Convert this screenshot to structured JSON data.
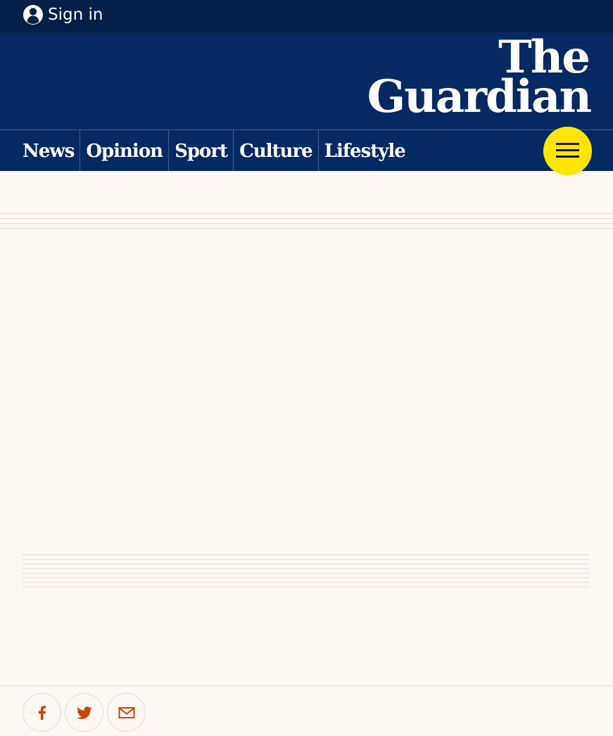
{
  "header": {
    "signin_label": "Sign in",
    "brand_line1": "The",
    "brand_line2": "Guardian"
  },
  "nav": {
    "items": [
      {
        "label": "News"
      },
      {
        "label": "Opinion"
      },
      {
        "label": "Sport"
      },
      {
        "label": "Culture"
      },
      {
        "label": "Lifestyle"
      }
    ],
    "menu_icon": "hamburger-icon"
  },
  "share": {
    "items": [
      {
        "icon": "facebook-icon"
      },
      {
        "icon": "twitter-icon"
      },
      {
        "icon": "email-icon"
      }
    ]
  },
  "colors": {
    "top_bar": "#041f4a",
    "brand_blue": "#052962",
    "page_background": "#fdf8f4",
    "menu_button": "#ffe500",
    "share_icon": "#c74600"
  }
}
